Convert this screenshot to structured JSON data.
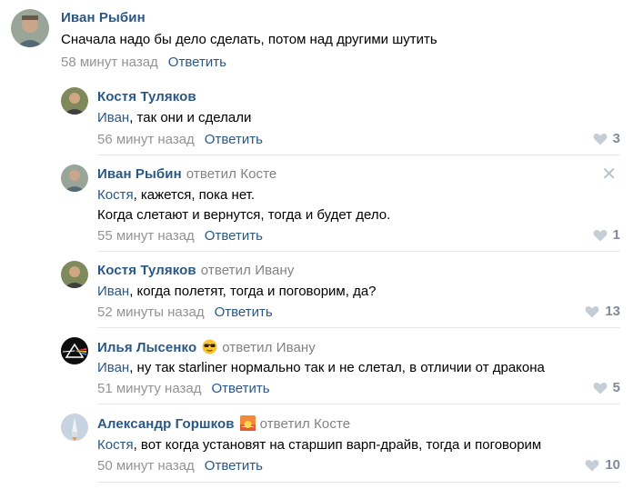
{
  "comments": [
    {
      "author": "Иван Рыбин",
      "reply_to": "",
      "text_mention": "",
      "text": "Сначала надо бы дело сделать, потом над другими шутить",
      "time": "58 минут назад",
      "reply_label": "Ответить",
      "likes": ""
    },
    {
      "author": "Костя Туляков",
      "reply_to": "",
      "text_mention": "Иван",
      "text": ", так они и сделали",
      "time": "56 минут назад",
      "reply_label": "Ответить",
      "likes": "3"
    },
    {
      "author": "Иван Рыбин",
      "reply_to": "ответил Косте",
      "text_mention": "Костя",
      "text": ", кажется, пока нет.",
      "text_line2": "Когда слетают и вернутся, тогда и будет дело.",
      "time": "55 минут назад",
      "reply_label": "Ответить",
      "likes": "1"
    },
    {
      "author": "Костя Туляков",
      "reply_to": "ответил Ивану",
      "text_mention": "Иван",
      "text": ", когда полетят, тогда и поговорим, да?",
      "time": "52 минуты назад",
      "reply_label": "Ответить",
      "likes": "13"
    },
    {
      "author": "Илья Лысенко",
      "reply_to": "ответил Ивану",
      "text_mention": "Иван",
      "text": ", ну так starliner нормально так и не слетал, в отличии от дракона",
      "time": "51 минуту назад",
      "reply_label": "Ответить",
      "likes": "5"
    },
    {
      "author": "Александр Горшков",
      "reply_to": "ответил Косте",
      "text_mention": "Костя",
      "text": ", вот когда установят на старшип варп-драйв, тогда и поговорим",
      "time": "50 минут назад",
      "reply_label": "Ответить",
      "likes": "10"
    }
  ],
  "colors": {
    "link": "#2a5885",
    "meta": "#939393",
    "like": "#828a99",
    "divider": "#e7e8ec"
  },
  "icons": {
    "like": "heart-icon",
    "close": "close-icon",
    "emoji_sunglasses": "sunglasses-emoji-icon",
    "emoji_sunset": "sunset-emoji-icon"
  }
}
